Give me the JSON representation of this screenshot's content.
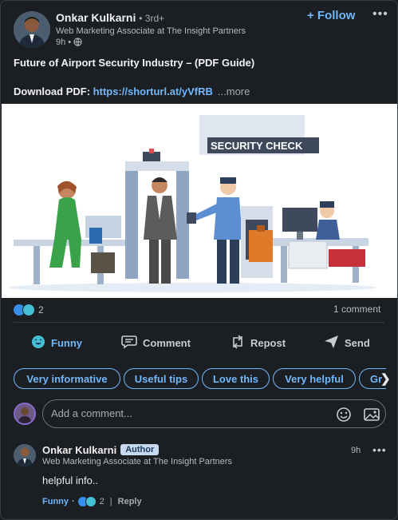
{
  "header": {
    "name": "Onkar Kulkarni",
    "degree": "• 3rd+",
    "headline": "Web Marketing Associate at The Insight Partners",
    "time": "9h •",
    "follow_label": "+ Follow",
    "more_icon": "ellipsis-icon"
  },
  "post": {
    "title_prefix": "Future of Airport Security Industry – (",
    "title_bold": "PDF Guide",
    "title_suffix": ")",
    "download_label": "Download PDF",
    "download_sep": ": ",
    "download_link": "https://shorturl.at/yVfRB",
    "more_label": "...more",
    "image_sign": "SECURITY CHECK"
  },
  "stats": {
    "reaction_count": "2",
    "comments": "1 comment"
  },
  "actions": [
    {
      "label": "Funny",
      "icon": "funny-emoji-icon"
    },
    {
      "label": "Comment",
      "icon": "comment-icon"
    },
    {
      "label": "Repost",
      "icon": "repost-icon"
    },
    {
      "label": "Send",
      "icon": "send-icon"
    }
  ],
  "chips": [
    "Very informative",
    "Useful tips",
    "Love this",
    "Very helpful",
    "Gr"
  ],
  "comment_input": {
    "placeholder": "Add a comment..."
  },
  "comment": {
    "name": "Onkar Kulkarni",
    "badge": "Author",
    "headline": "Web Marketing Associate at The Insight Partners",
    "time": "9h",
    "text": "helpful info..",
    "reaction_label": "Funny",
    "dot": "·",
    "reaction_count": "2",
    "separator": "|",
    "reply_label": "Reply"
  },
  "colors": {
    "accent": "#71b7fb",
    "background": "#1b1f23"
  }
}
